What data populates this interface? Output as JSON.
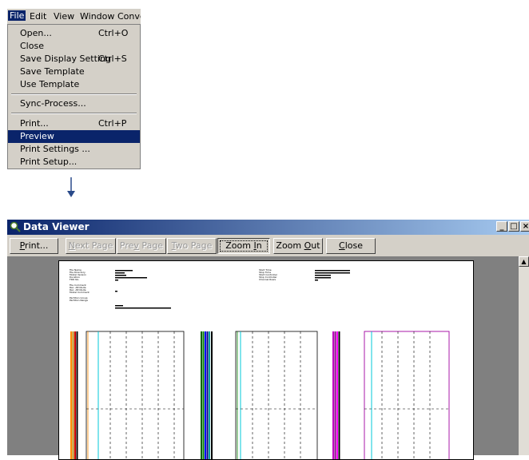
{
  "menubar": {
    "items": [
      "File",
      "Edit",
      "View",
      "Window",
      "Conver"
    ]
  },
  "file_menu": {
    "items": [
      {
        "label": "Open...",
        "shortcut": "Ctrl+O"
      },
      {
        "label": "Close",
        "shortcut": ""
      },
      {
        "label": "Save Display Setting",
        "shortcut": "Ctrl+S"
      },
      {
        "label": "Save Template",
        "shortcut": ""
      },
      {
        "label": "Use Template",
        "shortcut": ""
      },
      {
        "label": "Sync-Process...",
        "shortcut": ""
      },
      {
        "label": "Print...",
        "shortcut": "Ctrl+P"
      },
      {
        "label": "Preview",
        "shortcut": "",
        "selected": true
      },
      {
        "label": "Print Settings ...",
        "shortcut": ""
      },
      {
        "label": "Print Setup...",
        "shortcut": ""
      }
    ]
  },
  "arrow": {
    "icon": "arrow-down-icon",
    "color": "#2a4a8a"
  },
  "window": {
    "title": "Data Viewer",
    "title_icon": "magnifier-icon",
    "controls": {
      "minimize": "_",
      "maximize": "□",
      "close": "×"
    },
    "title_gradient": [
      "#0a246a",
      "#a6caf0"
    ]
  },
  "toolbar": {
    "print_pre": "",
    "print_u": "P",
    "print_post": "rint...",
    "next_pre": "",
    "next_u": "N",
    "next_post": "ext Page",
    "prev_pre": "Pre",
    "prev_u": "v",
    "prev_post": " Page",
    "two_pre": "",
    "two_u": "T",
    "two_post": "wo Page",
    "zoomin_pre": "Zoom ",
    "zoomin_u": "I",
    "zoomin_post": "n",
    "zoomout_pre": "Zoom ",
    "zoomout_u": "O",
    "zoomout_post": "ut",
    "close_pre": "",
    "close_u": "C",
    "close_post": "lose"
  },
  "preview": {
    "header_left": [
      "File Name",
      "File Directory",
      "Model Version",
      "Duration",
      "FDD No.",
      "File Comment",
      "Rec. Attribute",
      "Rec. Attribute",
      "Model Comment",
      "Partition Group",
      "Partition Range"
    ],
    "header_right": [
      "Start Time",
      "Stop Time",
      "Start Controller",
      "Stop Controller",
      "Channel Rows"
    ],
    "colors": {
      "group1": [
        "#ff8c00",
        "#b8860b",
        "#cc0000",
        "#000000"
      ],
      "group2": [
        "#008000",
        "#0000ff",
        "#006400",
        "#000080",
        "#00a0a0"
      ],
      "group3": [
        "#c000c0",
        "#800080",
        "#ff00ff"
      ],
      "cyan": "#00c8d8",
      "magenta_box": "#a000a0"
    }
  }
}
